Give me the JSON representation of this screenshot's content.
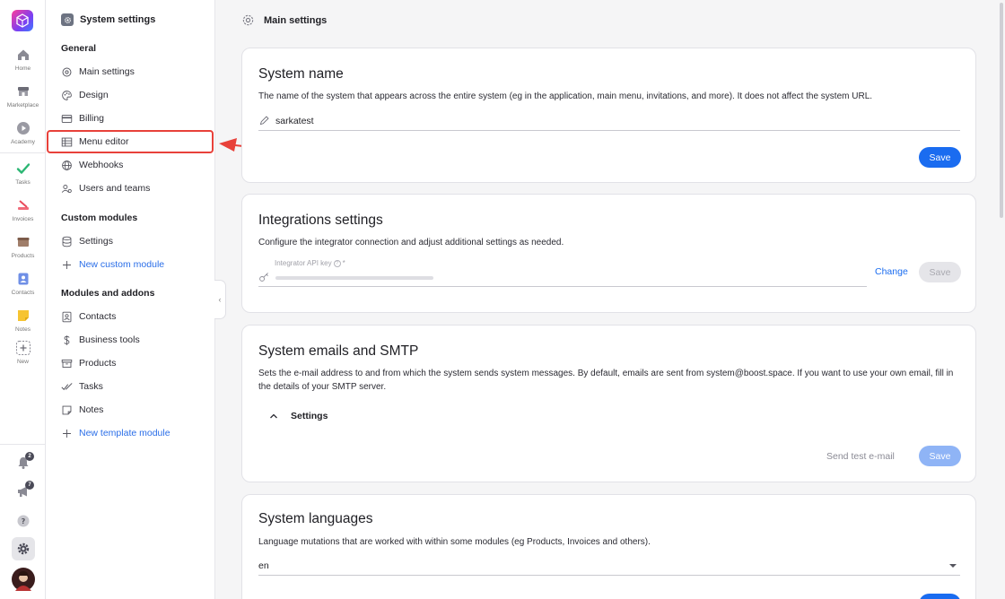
{
  "rail": {
    "items": [
      {
        "label": "Home",
        "icon": "home-icon"
      },
      {
        "label": "Marketplace",
        "icon": "marketplace-icon"
      },
      {
        "label": "Academy",
        "icon": "academy-icon"
      },
      {
        "label": "Tasks",
        "icon": "tasks-icon"
      },
      {
        "label": "Invoices",
        "icon": "invoices-icon"
      },
      {
        "label": "Products",
        "icon": "products-icon"
      },
      {
        "label": "Contacts",
        "icon": "contacts-icon"
      },
      {
        "label": "Notes",
        "icon": "notes-icon"
      },
      {
        "label": "New",
        "icon": "plus-icon"
      }
    ],
    "notifications_badge": "2",
    "announcements_badge": "7"
  },
  "sidebar": {
    "title": "System settings",
    "sections": {
      "general": "General",
      "custom_modules": "Custom modules",
      "modules_addons": "Modules and addons"
    },
    "general_items": [
      "Main settings",
      "Design",
      "Billing",
      "Menu editor",
      "Webhooks",
      "Users and teams"
    ],
    "custom_items": [
      "Settings",
      "New custom module"
    ],
    "module_items": [
      "Contacts",
      "Business tools",
      "Products",
      "Tasks",
      "Notes",
      "New template module"
    ]
  },
  "header": {
    "title": "Main settings"
  },
  "system_name": {
    "title": "System name",
    "description": "The name of the system that appears across the entire system (eg in the application, main menu, invitations, and more). It does not affect the system URL.",
    "value": "sarkatest",
    "save": "Save"
  },
  "integrations": {
    "title": "Integrations settings",
    "description": "Configure the integrator connection and adjust additional settings as needed.",
    "field_label": "Integrator API key",
    "required_mark": "*",
    "change": "Change",
    "save": "Save"
  },
  "emails": {
    "title": "System emails and SMTP",
    "description": "Sets the e-mail address to and from which the system sends system messages. By default, emails are sent from system@boost.space. If you want to use your own email, fill in the details of your SMTP server.",
    "settings_toggle": "Settings",
    "send_test": "Send test e-mail",
    "save": "Save"
  },
  "languages": {
    "title": "System languages",
    "description": "Language mutations that are worked with within some modules (eg Products, Invoices and others).",
    "value": "en"
  },
  "colors": {
    "accent": "#1a6cf0",
    "highlight": "#e8413a"
  }
}
